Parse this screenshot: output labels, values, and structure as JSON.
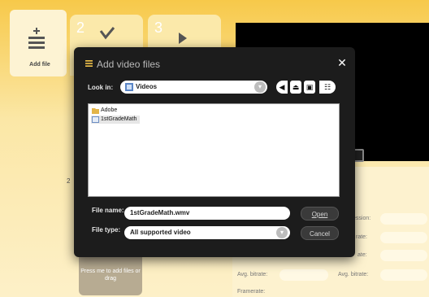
{
  "app": {
    "add_file_label": "Add file",
    "steps": [
      "2",
      "3"
    ],
    "side_number": "2",
    "drop_zone_text": "Press me to add files or drag",
    "props": {
      "avg_bitrate_left": "Avg. bitrate:",
      "avg_bitrate_right": "Avg. bitrate:",
      "framerate": "Framerate:",
      "partial_right_1": "ession:",
      "partial_right_2": "rate:",
      "partial_right_3": "ate:"
    }
  },
  "dialog": {
    "title": "Add video files",
    "look_in_label": "Look in:",
    "look_in_value": "Videos",
    "files": [
      {
        "name": "Adobe",
        "type": "folder"
      },
      {
        "name": "1stGradeMath",
        "type": "video"
      }
    ],
    "file_name_label": "File name:",
    "file_name_value": "1stGradeMath.wmv",
    "file_type_label": "File type:",
    "file_type_value": "All supported video",
    "open_label": "Open",
    "cancel_label": "Cancel",
    "close_glyph": "✕"
  },
  "colors": {
    "dialog_bg": "#1c1c1c",
    "app_accent": "#f7c94a",
    "preview_bg": "#000000"
  }
}
